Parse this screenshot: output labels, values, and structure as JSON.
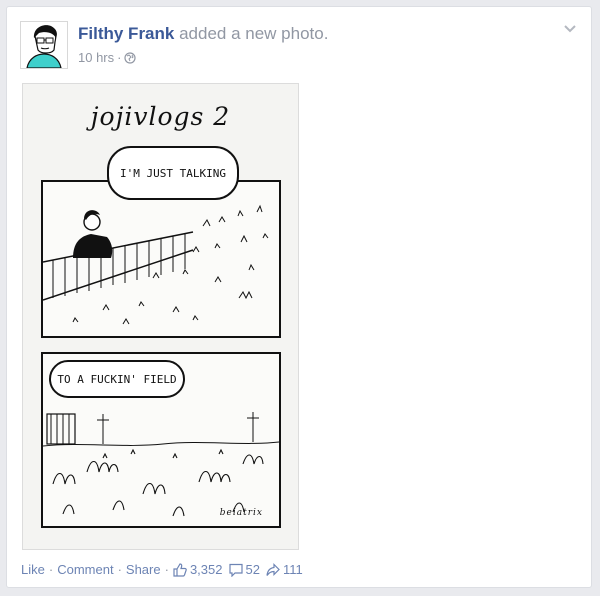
{
  "post": {
    "author": "Filthy Frank",
    "action": "added a new photo.",
    "time": "10 hrs",
    "time_separator": "·"
  },
  "photo": {
    "comic_title": "jojivlogs 2",
    "panel1_bubble": "I'M JUST TALKING",
    "panel2_bubble": "TO A FUCKIN' FIELD",
    "signature": "beiatrix"
  },
  "footer": {
    "like_label": "Like",
    "comment_label": "Comment",
    "share_label": "Share",
    "separator": "·",
    "likes_count": "3,352",
    "comments_count": "52",
    "shares_count": "111"
  },
  "icons": {
    "audience": "globe-icon",
    "menu": "chevron-down-icon",
    "likes": "thumbs-up-icon",
    "comments": "comment-icon",
    "shares": "share-arrow-icon"
  },
  "colors": {
    "author_link": "#3b5998",
    "footer_link": "#6d84b4",
    "muted": "#9197a3",
    "background": "#e9eaee"
  }
}
